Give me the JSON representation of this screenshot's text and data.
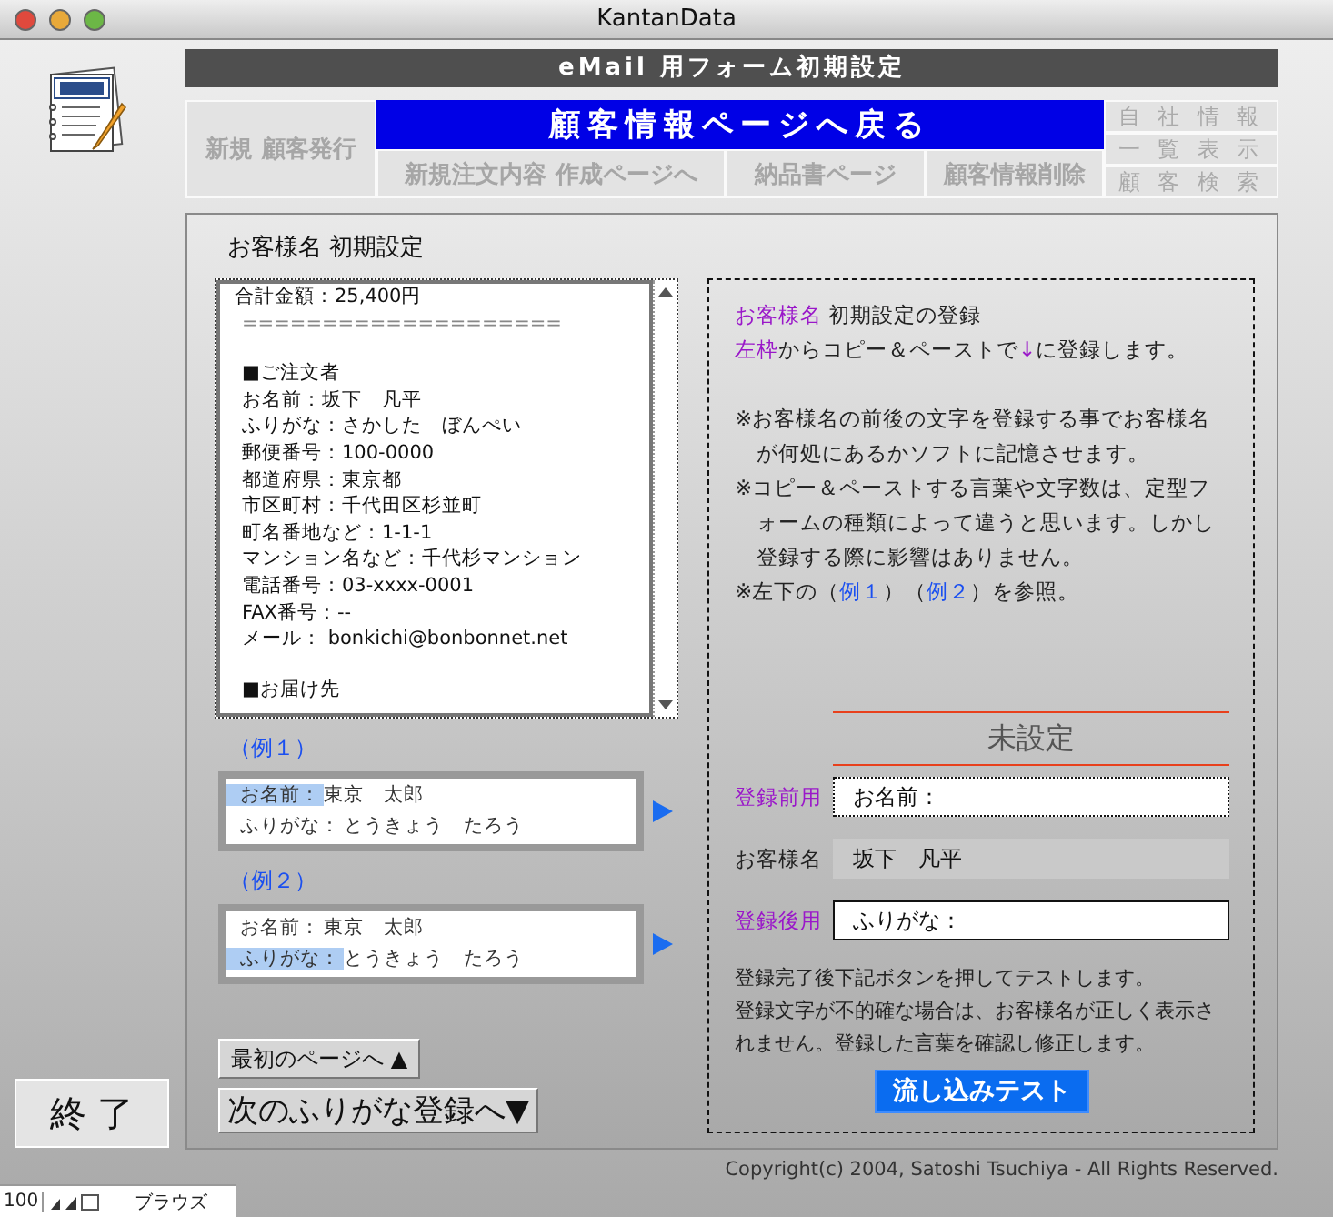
{
  "window": {
    "title": "KantanData"
  },
  "header": {
    "title": "eMail 用フォーム初期設定"
  },
  "nav": {
    "new_customer": "新規 顧客発行",
    "back_banner": "顧客情報ページへ戻る",
    "row_buttons": [
      "新規注文内容 作成ページへ",
      "納品書ページ",
      "顧客情報削除"
    ],
    "side_buttons": [
      "自 社 情 報",
      "一 覧 表 示",
      "顧 客 検 索"
    ]
  },
  "panel": {
    "title": "お客様名 初期設定"
  },
  "mail_text": {
    "blocks": [
      [
        "合計金額：25,400円",
        "===================="
      ],
      [
        "■ご注文者",
        "お名前：坂下　凡平",
        "ふりがな：さかした　ぼんぺい",
        "郵便番号：100-0000",
        "都道府県：東京都",
        "市区町村：千代田区杉並町",
        "町名番地など：1-1-1",
        "マンション名など：千代杉マンション",
        "電話番号：03-xxxx-0001",
        "FAX番号：--",
        "メール： bonkichi@bonbonnet.net"
      ],
      [
        "■お届け先"
      ]
    ]
  },
  "examples": [
    {
      "label": "（例１）",
      "lines": [
        {
          "label": "お名前：",
          "value": "東京　太郎",
          "selected": true
        },
        {
          "label": "ふりがな：",
          "value": "とうきょう　たろう",
          "selected": false
        }
      ]
    },
    {
      "label": "（例２）",
      "lines": [
        {
          "label": "お名前：",
          "value": "東京　太郎",
          "selected": false
        },
        {
          "label": "ふりがな：",
          "value": "とうきょう　たろう",
          "selected": true
        }
      ]
    }
  ],
  "nav_buttons": [
    {
      "label": "最初のページへ ▲",
      "kind": "small"
    },
    {
      "label": "次のふりがな登録へ▼",
      "kind": "large"
    }
  ],
  "quit_button": "終 了",
  "info": {
    "intro": [
      [
        {
          "text": "お客様名",
          "kind": "accent"
        },
        {
          "text": " 初期設定の登録",
          "kind": "plain"
        }
      ],
      [
        {
          "text": "左枠",
          "kind": "accent"
        },
        {
          "text": "からコピー＆ペーストで",
          "kind": "plain"
        },
        {
          "text": "↓",
          "kind": "accent"
        },
        {
          "text": "に登録します。",
          "kind": "plain"
        }
      ]
    ],
    "notes": [
      [
        {
          "text": "※お客様名の前後の文字を登録する事でお客様名が何処にあるかソフトに記憶させます。",
          "kind": "plain"
        }
      ],
      [
        {
          "text": "※コピー＆ペーストする言葉や文字数は、定型フォームの種類によって違うと思います。しかし登録する際に影響はありません。",
          "kind": "plain"
        }
      ],
      [
        {
          "text": "※左下の（",
          "kind": "plain"
        },
        {
          "text": "例１",
          "kind": "link"
        },
        {
          "text": "）（",
          "kind": "plain"
        },
        {
          "text": "例２",
          "kind": "link"
        },
        {
          "text": "）を参照。",
          "kind": "plain"
        }
      ]
    ]
  },
  "registration": {
    "status": "未設定",
    "fields": [
      {
        "label": "登録前用",
        "value": "お名前：",
        "kind": "before"
      },
      {
        "label": "お客様名",
        "value": "坂下　凡平",
        "kind": "result"
      },
      {
        "label": "登録後用",
        "value": "ふりがな：",
        "kind": "after"
      }
    ],
    "instructions": [
      "登録完了後下記ボタンを押してテストします。",
      "登録文字が不的確な場合は、お客様名が正しく表示されません。登録した言葉を確認し修正します。"
    ],
    "test_button": "流し込みテスト"
  },
  "copyright": "Copyright(c) 2004, Satoshi Tsuchiya - All Rights Reserved.",
  "status_bar": {
    "zoom": "100",
    "mode": "ブラウズ"
  }
}
